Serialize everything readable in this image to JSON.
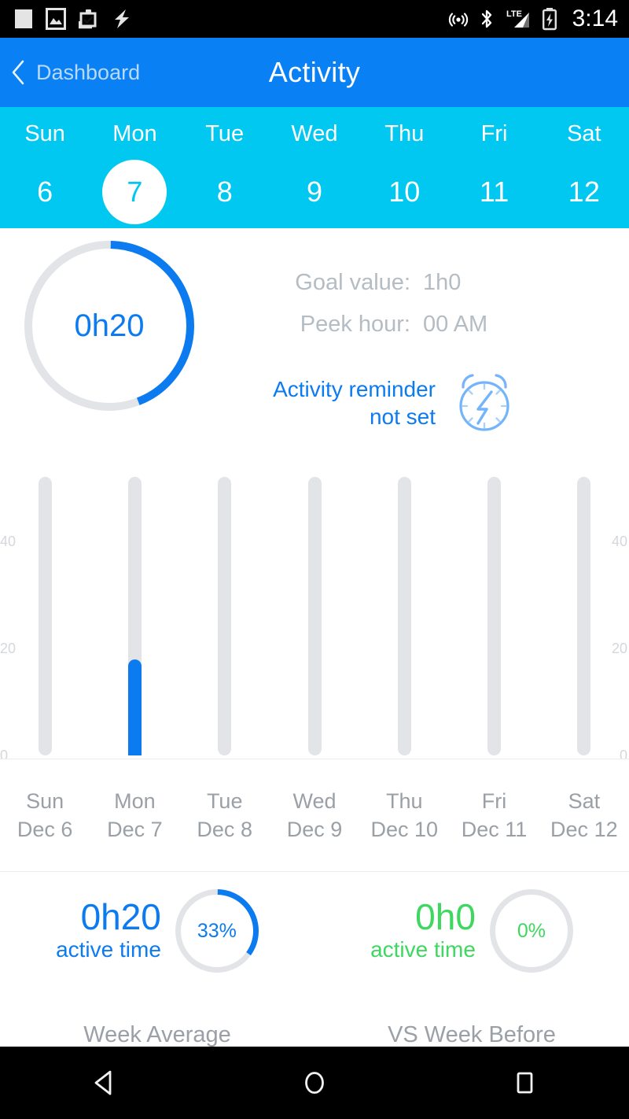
{
  "status_bar": {
    "time": "3:14",
    "left_icons": [
      "blank-document-icon",
      "photo-icon",
      "clipboard-check-icon",
      "lightning-bolt-icon"
    ],
    "right_icons": [
      "cast-icon",
      "bluetooth-icon",
      "lte-signal-icon",
      "battery-charging-icon"
    ]
  },
  "app_bar": {
    "back_label": "Dashboard",
    "title": "Activity",
    "background": "#0a80f5"
  },
  "day_strip": {
    "background": "#00c8f0",
    "selected_index": 1,
    "days": [
      {
        "name": "Sun",
        "num": "6"
      },
      {
        "name": "Mon",
        "num": "7"
      },
      {
        "name": "Tue",
        "num": "8"
      },
      {
        "name": "Wed",
        "num": "9"
      },
      {
        "name": "Thu",
        "num": "10"
      },
      {
        "name": "Fri",
        "num": "11"
      },
      {
        "name": "Sat",
        "num": "12"
      }
    ]
  },
  "summary": {
    "ring_value": "0h20",
    "ring_percent": 33,
    "accent": "#0d7bf0",
    "stats": [
      {
        "key": "Goal value:",
        "value": "1h0"
      },
      {
        "key": "Peek hour:",
        "value": "00 AM"
      }
    ],
    "reminder_line1": "Activity reminder",
    "reminder_line2": "not set"
  },
  "chart_data": {
    "type": "bar",
    "title": "",
    "xlabel": "",
    "ylabel": "",
    "ylim": [
      0,
      50
    ],
    "yticks": [
      0,
      20,
      40
    ],
    "ytick_labels": [
      "0",
      "20",
      "40"
    ],
    "axis_both_sides": true,
    "grid": false,
    "categories": [
      "Sun",
      "Mon",
      "Tue",
      "Wed",
      "Thu",
      "Fri",
      "Sat"
    ],
    "category_dates": [
      "Dec 6",
      "Dec 7",
      "Dec 8",
      "Dec 9",
      "Dec 10",
      "Dec 11",
      "Dec 12"
    ],
    "values": [
      0,
      18,
      0,
      0,
      0,
      0,
      0
    ],
    "track_max": 50,
    "bar_color": "#0d7bf0",
    "track_color": "#e2e4e8"
  },
  "footer": {
    "left": {
      "value": "0h20",
      "sub": "active time",
      "percent_label": "33%",
      "percent": 33,
      "caption": "Week Average",
      "color": "#0d7bf0"
    },
    "right": {
      "value": "0h0",
      "sub": "active time",
      "percent_label": "0%",
      "percent": 0,
      "caption": "VS Week Before",
      "color": "#3ed860"
    }
  },
  "nav_bar": {
    "buttons": [
      "back-triangle-icon",
      "home-circle-icon",
      "recents-square-icon"
    ]
  }
}
